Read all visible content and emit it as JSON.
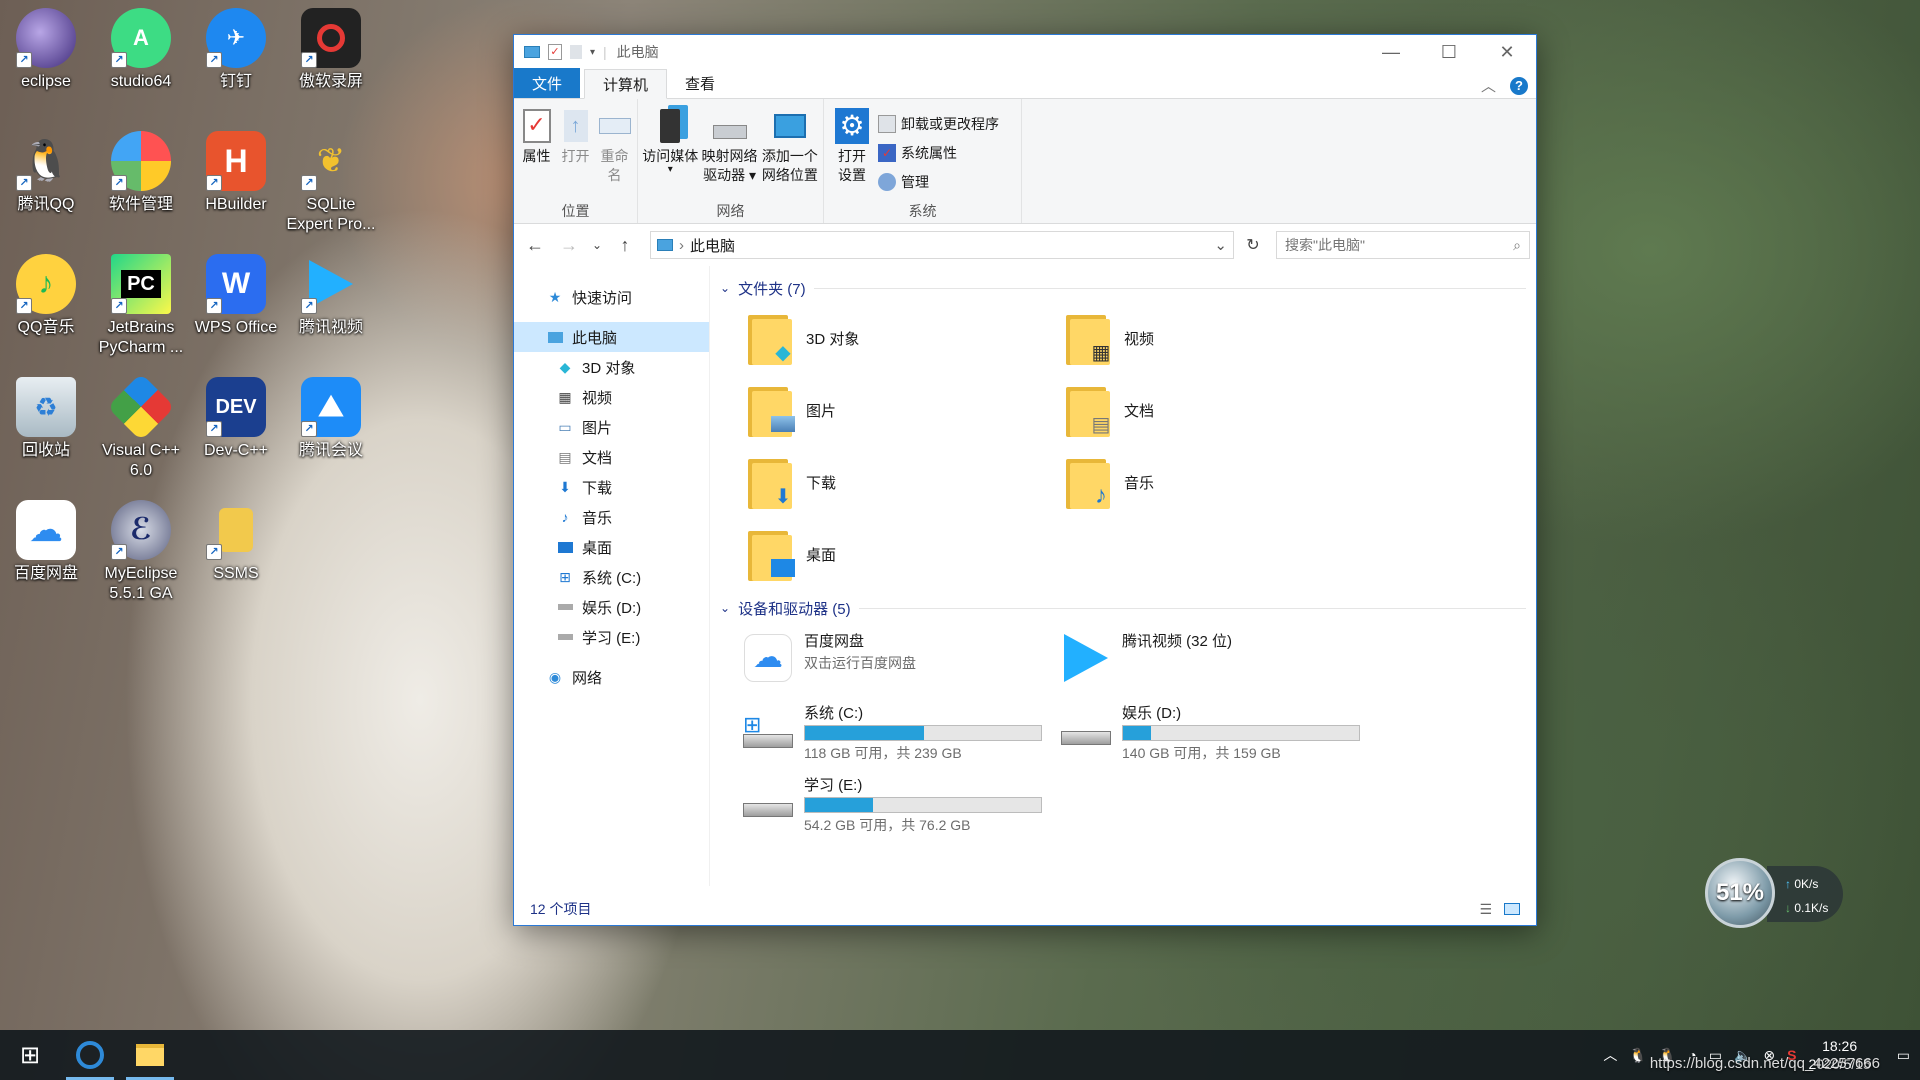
{
  "desktop": {
    "icons": [
      {
        "label": "eclipse"
      },
      {
        "label": "studio64"
      },
      {
        "label": "钉钉"
      },
      {
        "label": "傲软录屏"
      },
      {
        "label": "腾讯QQ"
      },
      {
        "label": "软件管理"
      },
      {
        "label": "HBuilder"
      },
      {
        "label": "SQLite Expert Pro..."
      },
      {
        "label": "QQ音乐"
      },
      {
        "label": "JetBrains PyCharm ..."
      },
      {
        "label": "WPS Office"
      },
      {
        "label": "腾讯视频"
      },
      {
        "label": "回收站"
      },
      {
        "label": "Visual C++ 6.0"
      },
      {
        "label": "Dev-C++"
      },
      {
        "label": "腾讯会议"
      },
      {
        "label": "百度网盘"
      },
      {
        "label": "MyEclipse 5.5.1 GA"
      },
      {
        "label": "SSMS"
      }
    ]
  },
  "window": {
    "title": "此电脑",
    "tabs": {
      "file": "文件",
      "computer": "计算机",
      "view": "查看"
    },
    "ribbon": {
      "location": {
        "label": "位置",
        "properties": "属性",
        "open": "打开",
        "rename": "重命名"
      },
      "network": {
        "label": "网络",
        "media_line1": "访问媒体",
        "map_line1": "映射网络",
        "map_line2": "驱动器",
        "add_line1": "添加一个",
        "add_line2": "网络位置"
      },
      "system": {
        "label": "系统",
        "open_settings_line1": "打开",
        "open_settings_line2": "设置",
        "uninstall": "卸载或更改程序",
        "sys_props": "系统属性",
        "manage": "管理"
      }
    },
    "address": {
      "path": "此电脑",
      "search_placeholder": "搜索\"此电脑\""
    },
    "nav": {
      "quick_access": "快速访问",
      "this_pc": "此电脑",
      "items": [
        "3D 对象",
        "视频",
        "图片",
        "文档",
        "下载",
        "音乐",
        "桌面",
        "系统 (C:)",
        "娱乐 (D:)",
        "学习 (E:)"
      ],
      "network": "网络"
    },
    "folders_header": "文件夹 (7)",
    "folders": [
      "3D 对象",
      "视频",
      "图片",
      "文档",
      "下载",
      "音乐",
      "桌面"
    ],
    "devices_header": "设备和驱动器 (5)",
    "devices": {
      "baidu": {
        "name": "百度网盘",
        "sub": "双击运行百度网盘"
      },
      "tencent": {
        "name": "腾讯视频 (32 位)"
      },
      "c": {
        "name": "系统 (C:)",
        "free": "118 GB 可用，共 239 GB",
        "used_fraction": 0.506
      },
      "d": {
        "name": "娱乐 (D:)",
        "free": "140 GB 可用，共 159 GB",
        "used_fraction": 0.12
      },
      "e": {
        "name": "学习 (E:)",
        "free": "54.2 GB 可用，共 76.2 GB",
        "used_fraction": 0.289
      }
    },
    "status": "12 个项目"
  },
  "net_widget": {
    "percent": "51%",
    "up": "0K/s",
    "down": "0.1K/s"
  },
  "taskbar": {
    "time": "18:26",
    "date": "2020/5/15"
  },
  "watermark": "https://blog.csdn.net/qq_42257666",
  "colors": {
    "accent": "#1979ca",
    "drive_fill": "#26a0da",
    "selected": "#cce8ff"
  }
}
